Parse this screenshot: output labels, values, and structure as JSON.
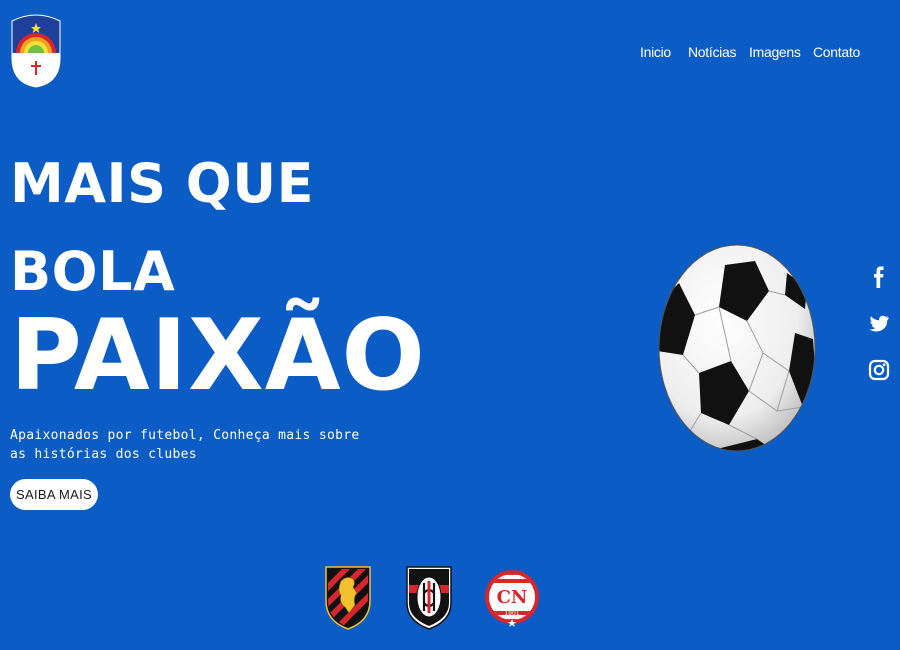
{
  "header": {
    "logo_icon": "pernambuco-flag-icon",
    "nav": [
      {
        "label": "Inicio"
      },
      {
        "label": "Notícias"
      },
      {
        "label": "Imagens"
      },
      {
        "label": "Contato"
      }
    ]
  },
  "hero": {
    "line1": "MAIS QUE",
    "line2": "BOLA",
    "line3": "PAIXÃO",
    "subtitle": "Apaixonados por futebol, Conheça mais sobre as histórias dos clubes",
    "cta_label": "SAIBA MAIS",
    "image_icon": "soccer-ball-icon"
  },
  "social": [
    {
      "icon": "facebook-icon"
    },
    {
      "icon": "twitter-icon"
    },
    {
      "icon": "instagram-icon"
    }
  ],
  "clubs": [
    {
      "icon": "sport-recife-crest-icon"
    },
    {
      "icon": "santa-cruz-crest-icon"
    },
    {
      "icon": "nautico-crest-icon",
      "year": "1901"
    }
  ],
  "colors": {
    "background": "#0b5cc4",
    "text": "#ffffff",
    "button_bg": "#ffffff",
    "button_text": "#1a1a1a"
  }
}
